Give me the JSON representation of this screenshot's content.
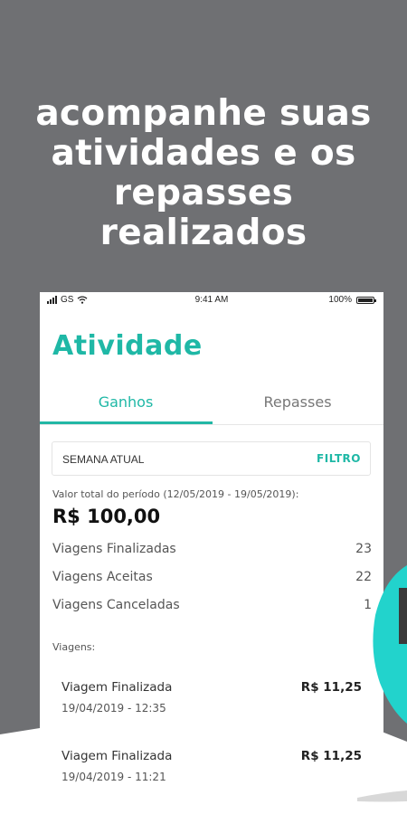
{
  "promo": {
    "headline_lines": [
      "acompanhe suas",
      "atividades e os",
      "repasses",
      "realizados"
    ],
    "colors": {
      "background": "#6f7073",
      "accent": "#1fb8a6",
      "teal_decoration": "#22d3cc"
    }
  },
  "status_bar": {
    "carrier": "GS",
    "time": "9:41 AM",
    "battery": "100%",
    "icons": [
      "signal-icon",
      "wifi-icon",
      "battery-icon"
    ]
  },
  "screen": {
    "title": "Atividade",
    "tabs": [
      {
        "label": "Ganhos",
        "active": true
      },
      {
        "label": "Repasses",
        "active": false
      }
    ],
    "filter": {
      "period": "SEMANA ATUAL",
      "button": "FILTRO"
    },
    "total": {
      "label": "Valor total do período (12/05/2019 - 19/05/2019):",
      "value": "R$ 100,00"
    },
    "stats": [
      {
        "label": "Viagens Finalizadas",
        "value": "23"
      },
      {
        "label": "Viagens Aceitas",
        "value": "22"
      },
      {
        "label": "Viagens Canceladas",
        "value": "1"
      }
    ],
    "trips_label": "Viagens:",
    "trips": [
      {
        "title": "Viagem Finalizada",
        "date": "19/04/2019 - 12:35",
        "amount": "R$ 11,25"
      },
      {
        "title": "Viagem Finalizada",
        "date": "19/04/2019 - 11:21",
        "amount": "R$ 11,25"
      }
    ]
  }
}
